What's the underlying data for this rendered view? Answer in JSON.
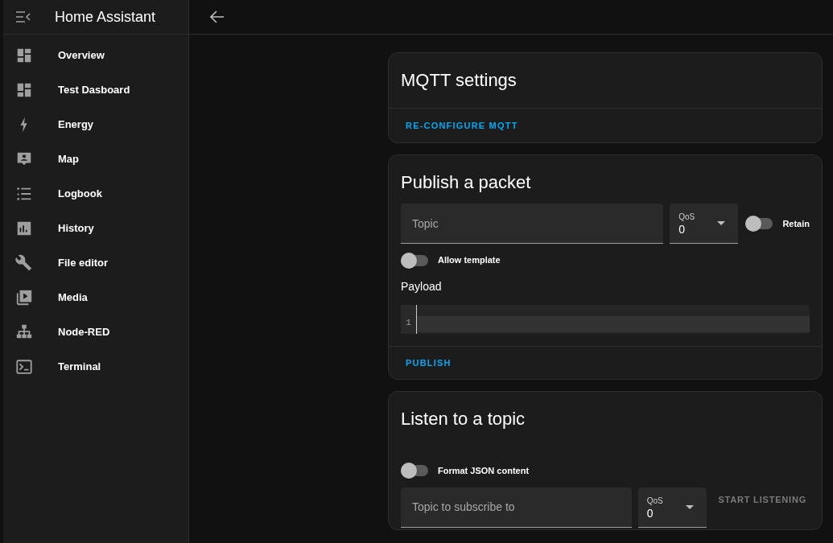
{
  "sidebar": {
    "title": "Home Assistant",
    "items": [
      {
        "label": "Overview",
        "selected": false
      },
      {
        "label": "Test Dasboard",
        "selected": false
      },
      {
        "label": "Energy",
        "selected": false
      },
      {
        "label": "Map",
        "selected": false
      },
      {
        "label": "Logbook",
        "selected": false
      },
      {
        "label": "History",
        "selected": false
      },
      {
        "label": "File editor",
        "selected": false
      },
      {
        "label": "Media",
        "selected": false
      },
      {
        "label": "Node-RED",
        "selected": false
      },
      {
        "label": "Terminal",
        "selected": false
      }
    ]
  },
  "mqtt_settings": {
    "title": "MQTT settings",
    "action": "RE-CONFIGURE MQTT"
  },
  "publish": {
    "title": "Publish a packet",
    "topic": {
      "placeholder": "Topic"
    },
    "qos": {
      "label": "QoS",
      "value": "0"
    },
    "retain": {
      "label": "Retain",
      "on": false
    },
    "allow_template": {
      "label": "Allow template",
      "on": false
    },
    "payload_label": "Payload",
    "editor": {
      "line_number": "1"
    },
    "action": "PUBLISH"
  },
  "listen": {
    "title": "Listen to a topic",
    "format_json": {
      "label": "Format JSON content",
      "on": false
    },
    "topic": {
      "placeholder": "Topic to subscribe to"
    },
    "qos": {
      "label": "QoS",
      "value": "0"
    },
    "action": {
      "label": "START LISTENING",
      "disabled": true
    }
  }
}
